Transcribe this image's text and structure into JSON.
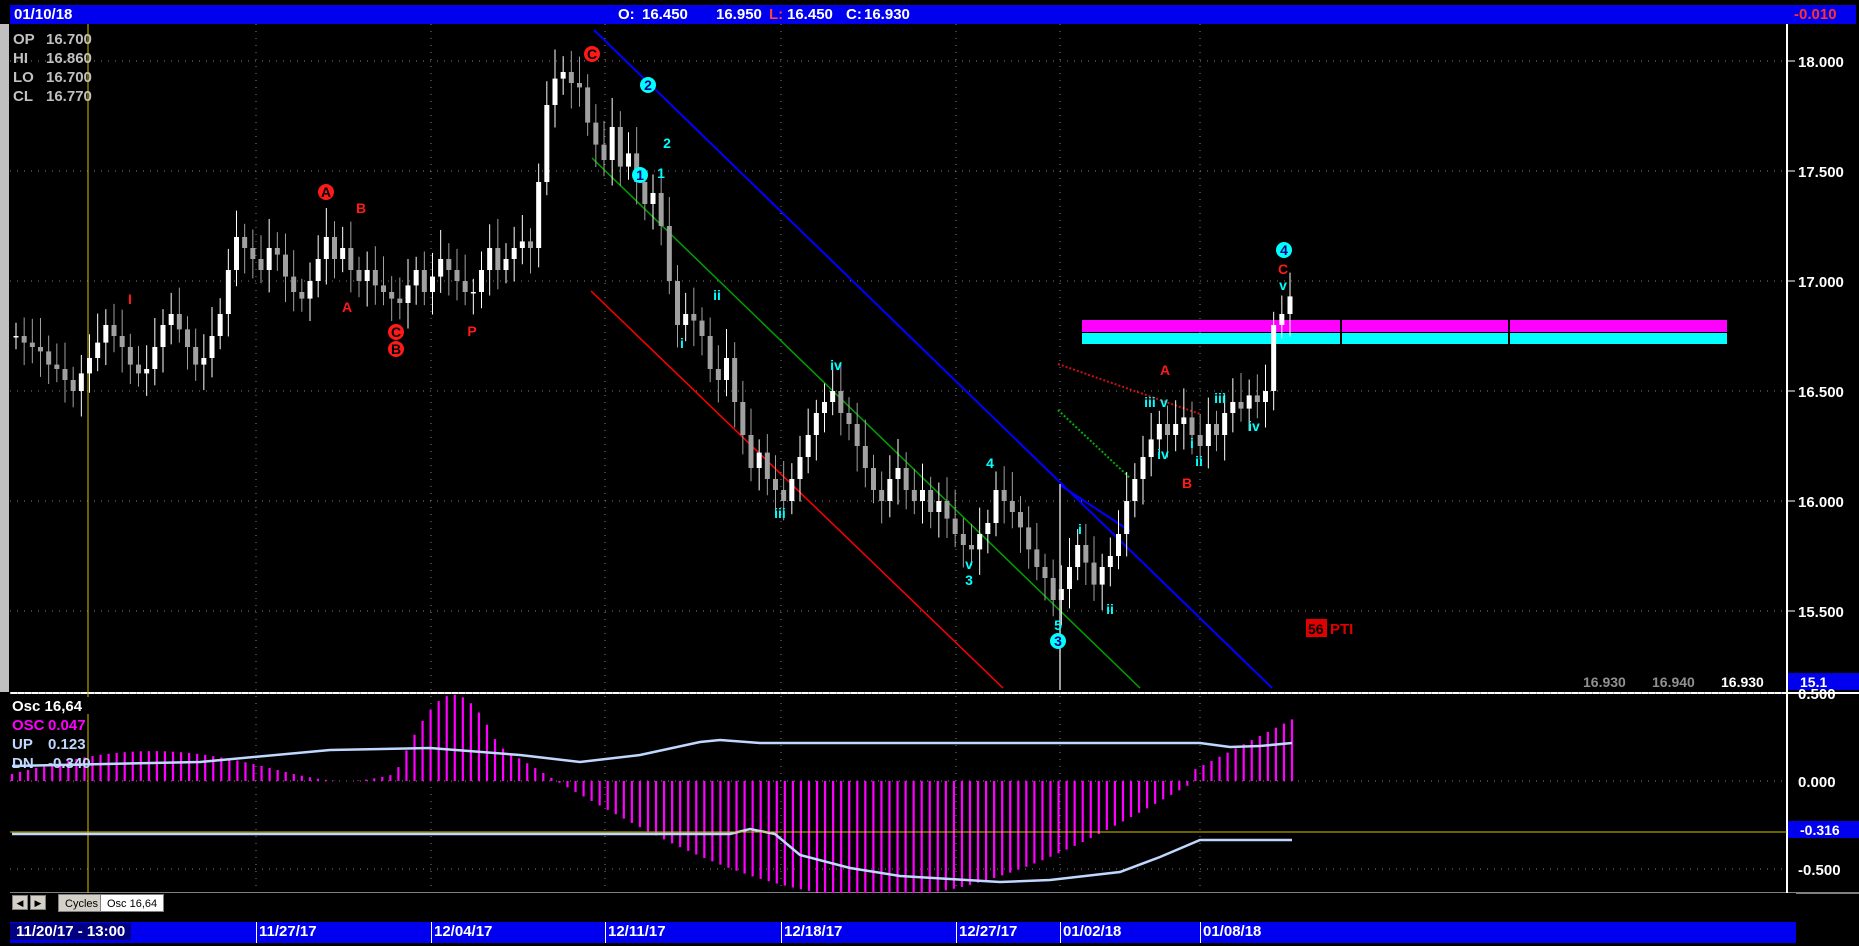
{
  "header": {
    "date": "01/10/18",
    "open_label": "O:",
    "open": "16.450",
    "high": "16.950",
    "low_label": "L:",
    "low": "16.450",
    "close_label": "C:",
    "close": "16.930",
    "change": "-0.010"
  },
  "ohlc_box": [
    {
      "label": "OP",
      "value": "16.700"
    },
    {
      "label": "HI",
      "value": "16.860"
    },
    {
      "label": "LO",
      "value": "16.700"
    },
    {
      "label": "CL",
      "value": "16.770"
    }
  ],
  "price_axis": {
    "ticks": [
      "18.000",
      "17.500",
      "17.000",
      "16.500",
      "16.000",
      "15.500"
    ],
    "marker": "15.1"
  },
  "bottom_values": [
    "16.930",
    "16.940",
    "16.930"
  ],
  "pti": {
    "value": "56",
    "label": "PTI"
  },
  "osc_legend": [
    {
      "label": "Osc 16,64",
      "value": ""
    },
    {
      "label": "OSC",
      "value": "0.047"
    },
    {
      "label": "UP",
      "value": "0.123"
    },
    {
      "label": "DN",
      "value": "-0.340"
    }
  ],
  "osc_axis": {
    "ticks": [
      "0.500",
      "0.000",
      "-0.500"
    ],
    "marker": "-0.316"
  },
  "tabs": [
    {
      "label": "Cycles"
    },
    {
      "label": "Osc 16,64"
    }
  ],
  "dates": {
    "first": "11/20/17 - 13:00",
    "labels": [
      "11/27/17",
      "12/04/17",
      "12/11/17",
      "12/18/17",
      "12/27/17",
      "01/02/18",
      "01/08/18"
    ]
  },
  "wave_labels": [
    "A",
    "B",
    "A",
    "C",
    "B",
    "I",
    "P",
    "C",
    "1",
    "2",
    "1",
    "2",
    "i",
    "ii",
    "iii",
    "iv",
    "v",
    "3",
    "4",
    "5",
    "3",
    "i",
    "ii",
    "iii",
    "iv",
    "v",
    "i",
    "ii",
    "A",
    "B",
    "iii",
    "iv",
    "4",
    "C",
    "v"
  ],
  "colors": {
    "up": "#ffffff",
    "down": "#a0a0a0",
    "red": "#ff0000",
    "cyan": "#00ffff",
    "magenta": "#ff00ff",
    "blue": "#0000ff",
    "green": "#00a000"
  },
  "chart_data": [
    {
      "type": "candlestick",
      "title": "",
      "x": "daily bars 11/20/17 - 01/10/18",
      "ylim": [
        15.1,
        18.2
      ],
      "close_series": [
        16.75,
        16.72,
        16.7,
        16.68,
        16.62,
        16.6,
        16.55,
        16.5,
        16.58,
        16.65,
        16.72,
        16.8,
        16.75,
        16.7,
        16.62,
        16.58,
        16.6,
        16.7,
        16.8,
        16.85,
        16.78,
        16.7,
        16.62,
        16.65,
        16.75,
        16.85,
        17.05,
        17.2,
        17.15,
        17.1,
        17.05,
        17.15,
        17.12,
        17.02,
        16.95,
        16.92,
        17.0,
        17.1,
        17.2,
        17.1,
        17.15,
        17.05,
        17.0,
        17.05,
        16.98,
        16.95,
        16.92,
        16.9,
        16.98,
        17.05,
        16.95,
        17.02,
        17.1,
        17.05,
        17.0,
        16.95,
        16.95,
        17.05,
        17.15,
        17.05,
        17.1,
        17.15,
        17.18,
        17.15,
        17.45,
        17.8,
        17.92,
        17.95,
        17.9,
        17.88,
        17.72,
        17.62,
        17.55,
        17.7,
        17.52,
        17.58,
        17.45,
        17.35,
        17.4,
        17.25,
        17.0,
        16.8,
        16.85,
        16.82,
        16.75,
        16.6,
        16.55,
        16.65,
        16.45,
        16.3,
        16.15,
        16.22,
        16.1,
        16.05,
        16.0,
        16.1,
        16.2,
        16.3,
        16.4,
        16.45,
        16.5,
        16.4,
        16.35,
        16.25,
        16.15,
        16.05,
        16.0,
        16.1,
        16.15,
        16.05,
        16.0,
        16.05,
        15.95,
        16.0,
        15.92,
        15.85,
        15.8,
        15.78,
        15.85,
        15.9,
        16.05,
        16.0,
        15.95,
        15.88,
        15.78,
        15.7,
        15.65,
        15.55,
        15.6,
        15.7,
        15.8,
        15.72,
        15.62,
        15.7,
        15.75,
        15.85,
        16.0,
        16.1,
        16.2,
        16.28,
        16.35,
        16.3,
        16.35,
        16.38,
        16.3,
        16.25,
        16.35,
        16.3,
        16.4,
        16.45,
        16.42,
        16.48,
        16.45,
        16.5,
        16.8,
        16.85,
        16.93
      ]
    },
    {
      "type": "bar",
      "title": "Osc 16,64",
      "ylim": [
        -0.75,
        0.55
      ],
      "series": [
        {
          "name": "OSC",
          "values": [
            0.047
          ]
        },
        {
          "name": "UP",
          "values": [
            0.123
          ]
        },
        {
          "name": "DN",
          "values": [
            -0.34
          ]
        }
      ]
    }
  ]
}
